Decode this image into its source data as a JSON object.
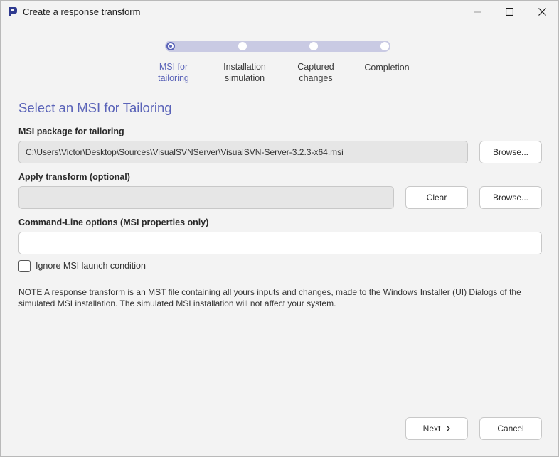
{
  "window": {
    "title": "Create a response transform"
  },
  "stepper": {
    "steps": [
      {
        "label_line1": "MSI for",
        "label_line2": "tailoring"
      },
      {
        "label_line1": "Installation",
        "label_line2": "simulation"
      },
      {
        "label_line1": "Captured",
        "label_line2": "changes"
      },
      {
        "label_line1": "Completion",
        "label_line2": ""
      }
    ],
    "active_index": 0
  },
  "main": {
    "heading": "Select an MSI for Tailoring",
    "msi_package": {
      "label": "MSI package for tailoring",
      "value": "C:\\Users\\Victor\\Desktop\\Sources\\VisualSVNServer\\VisualSVN-Server-3.2.3-x64.msi",
      "browse_label": "Browse..."
    },
    "transform": {
      "label": "Apply transform (optional)",
      "value": "",
      "clear_label": "Clear",
      "browse_label": "Browse..."
    },
    "command_line": {
      "label": "Command-Line options (MSI properties only)",
      "value": ""
    },
    "ignore_launch": {
      "label": "Ignore MSI launch condition",
      "checked": false
    },
    "note_line1": "NOTE  A response transform is an MST file containing all yours inputs and changes, made to the Windows Installer (UI) Dialogs of the",
    "note_line2": "simulated MSI installation. The simulated MSI installation will not affect your system."
  },
  "footer": {
    "next_label": "Next",
    "cancel_label": "Cancel"
  },
  "colors": {
    "accent": "#5a63b8",
    "track": "#c9cae3",
    "background": "#f3f3f3"
  }
}
